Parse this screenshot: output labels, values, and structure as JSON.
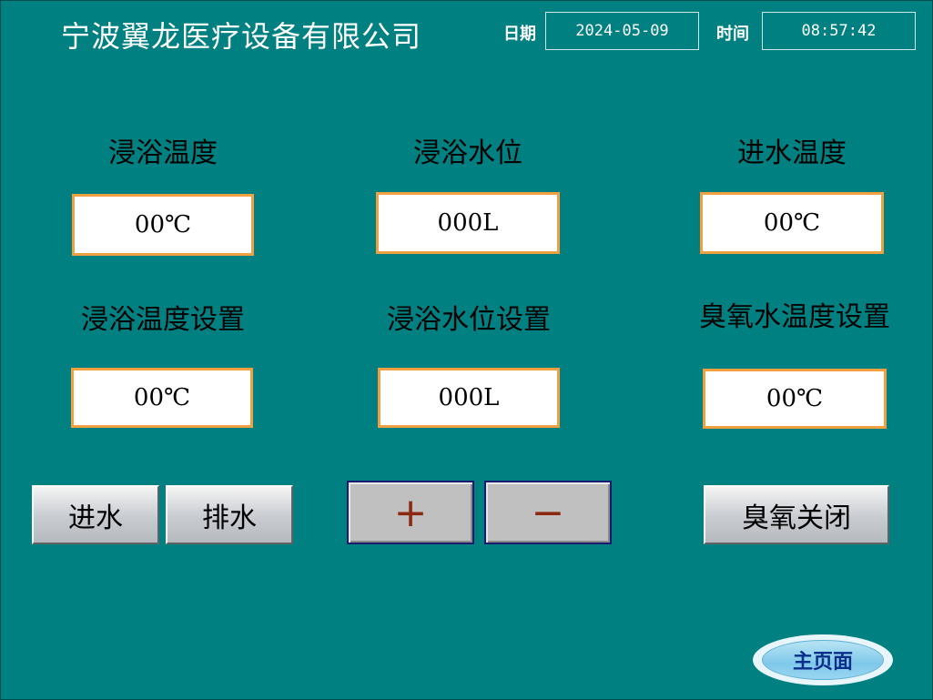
{
  "header": {
    "company": "宁波翼龙医疗设备有限公司",
    "date_label": "日期",
    "date_value": "2024-05-09",
    "time_label": "时间",
    "time_value": "08:57:42"
  },
  "readings": {
    "bath_temp_label": "浸浴温度",
    "bath_temp_value": "00℃",
    "bath_level_label": "浸浴水位",
    "bath_level_value": "000L",
    "inlet_temp_label": "进水温度",
    "inlet_temp_value": "00℃"
  },
  "settings": {
    "bath_temp_set_label": "浸浴温度设置",
    "bath_temp_set_value": "00℃",
    "bath_level_set_label": "浸浴水位设置",
    "bath_level_set_value": "000L",
    "ozone_temp_set_label": "臭氧水温度设置",
    "ozone_temp_set_value": "00℃"
  },
  "controls": {
    "inlet_label": "进水",
    "drain_label": "排水",
    "plus_label": "+",
    "minus_label": "−",
    "ozone_label": "臭氧关闭",
    "home_label": "主页面"
  }
}
